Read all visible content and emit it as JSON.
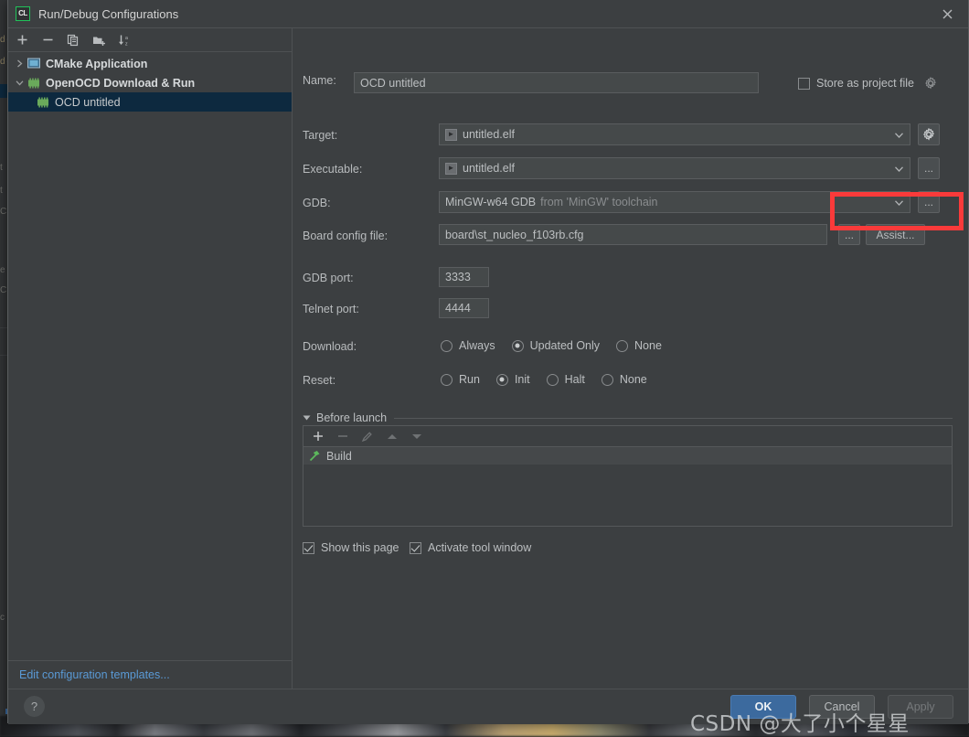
{
  "window": {
    "title": "Run/Debug Configurations",
    "logo_text": "CL",
    "logo_icon": "clion-logo-icon",
    "close_icon": "close-icon"
  },
  "sidebar": {
    "toolbar": [
      {
        "name": "add-configuration-button",
        "icon": "plus-icon"
      },
      {
        "name": "remove-configuration-button",
        "icon": "minus-icon"
      },
      {
        "name": "copy-configuration-button",
        "icon": "copy-icon"
      },
      {
        "name": "new-folder-button",
        "icon": "folder-add-icon"
      },
      {
        "name": "sort-configurations-button",
        "icon": "sort-alphabetical-icon"
      }
    ],
    "tree": [
      {
        "label": "CMake Application",
        "icon": "cmake-application-icon",
        "expanded": false,
        "level": 1,
        "selected": false,
        "group": true
      },
      {
        "label": "OpenOCD Download & Run",
        "icon": "openocd-icon",
        "expanded": true,
        "level": 1,
        "selected": false,
        "group": true
      },
      {
        "label": "OCD untitled",
        "icon": "openocd-icon",
        "level": 2,
        "selected": true,
        "group": false
      }
    ],
    "edit_templates_link": "Edit configuration templates..."
  },
  "form": {
    "name_label": "Name:",
    "name_value": "OCD untitled",
    "store_as_project_file_label": "Store as project file",
    "store_as_project_file_checked": false,
    "store_gear_icon": "gear-icon",
    "target_label": "Target:",
    "target_value": "untitled.elf",
    "target_icon": "elf-binary-icon",
    "target_settings_icon": "gear-icon",
    "executable_label": "Executable:",
    "executable_value": "untitled.elf",
    "executable_icon": "elf-binary-icon",
    "executable_browse_label": "...",
    "gdb_label": "GDB:",
    "gdb_value": "MinGW-w64 GDB",
    "gdb_value_suffix": "from 'MinGW' toolchain",
    "gdb_browse_label": "...",
    "board_config_label": "Board config file:",
    "board_config_value": "board\\st_nucleo_f103rb.cfg",
    "board_browse_label": "...",
    "board_assist_label": "Assist...",
    "gdb_port_label": "GDB port:",
    "gdb_port_value": "3333",
    "telnet_port_label": "Telnet port:",
    "telnet_port_value": "4444",
    "download_label": "Download:",
    "download_options": [
      {
        "label": "Always",
        "checked": false
      },
      {
        "label": "Updated Only",
        "checked": true
      },
      {
        "label": "None",
        "checked": false
      }
    ],
    "reset_label": "Reset:",
    "reset_options": [
      {
        "label": "Run",
        "checked": false
      },
      {
        "label": "Init",
        "checked": true
      },
      {
        "label": "Halt",
        "checked": false
      },
      {
        "label": "None",
        "checked": false
      }
    ],
    "before_launch_title": "Before launch",
    "before_launch_collapse_icon": "triangle-down-icon",
    "before_launch_toolbar": [
      {
        "name": "add-task-button",
        "icon": "plus-icon",
        "enabled": true
      },
      {
        "name": "remove-task-button",
        "icon": "minus-icon",
        "enabled": false
      },
      {
        "name": "edit-task-button",
        "icon": "pencil-icon",
        "enabled": false
      },
      {
        "name": "move-task-up-button",
        "icon": "arrow-up-icon",
        "enabled": false
      },
      {
        "name": "move-task-down-button",
        "icon": "arrow-down-icon",
        "enabled": false
      }
    ],
    "before_launch_tasks": [
      {
        "label": "Build",
        "icon": "hammer-icon"
      }
    ],
    "show_this_page_label": "Show this page",
    "show_this_page_checked": true,
    "activate_tool_window_label": "Activate tool window",
    "activate_tool_window_checked": true
  },
  "footer": {
    "help_label": "?",
    "ok_label": "OK",
    "cancel_label": "Cancel",
    "apply_label": "Apply"
  },
  "annotation": {
    "highlight_color": "#fa3a3a",
    "highlight_target": "board-config-buttons"
  },
  "watermark": {
    "text": "CSDN @大了小个星星"
  },
  "colors": {
    "dialog_bg": "#3c3f41",
    "field_bg": "#45494a",
    "selection_bg": "#0d293f",
    "accent_button": "#3c6a9e",
    "link": "#5a9ad6",
    "highlight": "#fa3a3a",
    "text": "#bcbfc1"
  },
  "background_ghost": {
    "lines": [
      "d -",
      "d -",
      "t",
      "t",
      "C",
      "e",
      "C",
      "c"
    ]
  }
}
